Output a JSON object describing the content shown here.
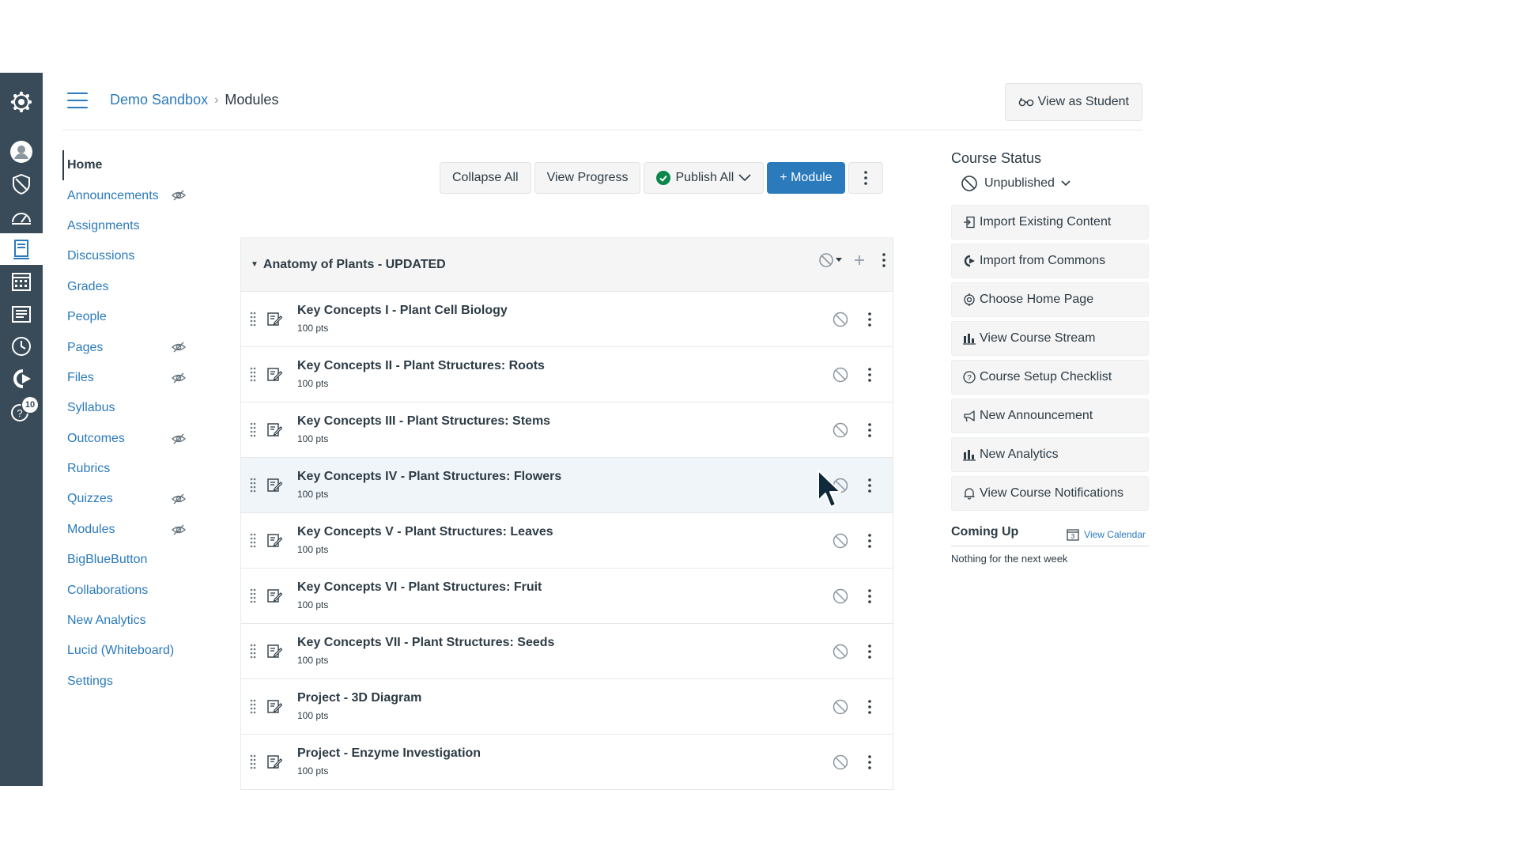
{
  "breadcrumb": {
    "course": "Demo Sandbox",
    "separator": "›",
    "current": "Modules"
  },
  "header": {
    "view_as_student": "View as Student"
  },
  "global_nav": {
    "icons": [
      "logo-icon",
      "account-icon",
      "admin-icon",
      "dashboard-icon",
      "courses-icon",
      "calendar-icon",
      "inbox-icon",
      "history-icon",
      "commons-icon",
      "help-icon"
    ],
    "help_badge": "10"
  },
  "course_nav": {
    "items": [
      {
        "label": "Home",
        "active": true,
        "hidden": false
      },
      {
        "label": "Announcements",
        "hidden": true
      },
      {
        "label": "Assignments",
        "hidden": false
      },
      {
        "label": "Discussions",
        "hidden": false
      },
      {
        "label": "Grades",
        "hidden": false
      },
      {
        "label": "People",
        "hidden": false
      },
      {
        "label": "Pages",
        "hidden": true
      },
      {
        "label": "Files",
        "hidden": true
      },
      {
        "label": "Syllabus",
        "hidden": false
      },
      {
        "label": "Outcomes",
        "hidden": true
      },
      {
        "label": "Rubrics",
        "hidden": false
      },
      {
        "label": "Quizzes",
        "hidden": true
      },
      {
        "label": "Modules",
        "hidden": true
      },
      {
        "label": "BigBlueButton",
        "hidden": false
      },
      {
        "label": "Collaborations",
        "hidden": false
      },
      {
        "label": "New Analytics",
        "hidden": false
      },
      {
        "label": "Lucid (Whiteboard)",
        "hidden": false
      },
      {
        "label": "Settings",
        "hidden": false
      }
    ]
  },
  "toolbar": {
    "collapse_all": "Collapse All",
    "view_progress": "View Progress",
    "publish_all": "Publish All",
    "add_module": "+ Module"
  },
  "module": {
    "title": "Anatomy of Plants - UPDATED",
    "items": [
      {
        "title": "Key Concepts I - Plant Cell Biology",
        "points": "100 pts"
      },
      {
        "title": "Key Concepts II - Plant Structures: Roots",
        "points": "100 pts"
      },
      {
        "title": "Key Concepts III - Plant Structures: Stems",
        "points": "100 pts"
      },
      {
        "title": "Key Concepts IV - Plant Structures: Flowers",
        "points": "100 pts",
        "hovered": true
      },
      {
        "title": "Key Concepts V - Plant Structures: Leaves",
        "points": "100 pts"
      },
      {
        "title": "Key Concepts VI - Plant Structures: Fruit",
        "points": "100 pts"
      },
      {
        "title": "Key Concepts VII - Plant Structures: Seeds",
        "points": "100 pts"
      },
      {
        "title": "Project - 3D Diagram",
        "points": "100 pts"
      },
      {
        "title": "Project - Enzyme Investigation",
        "points": "100 pts"
      }
    ]
  },
  "sidebar": {
    "course_status_title": "Course Status",
    "status_value": "Unpublished",
    "buttons": [
      {
        "label": "Import Existing Content",
        "icon": "import-icon"
      },
      {
        "label": "Import from Commons",
        "icon": "commons-icon"
      },
      {
        "label": "Choose Home Page",
        "icon": "target-icon"
      },
      {
        "label": "View Course Stream",
        "icon": "bar-chart-icon"
      },
      {
        "label": "Course Setup Checklist",
        "icon": "question-icon"
      },
      {
        "label": "New Announcement",
        "icon": "megaphone-icon"
      },
      {
        "label": "New Analytics",
        "icon": "bar-chart-icon"
      },
      {
        "label": "View Course Notifications",
        "icon": "bell-icon"
      }
    ],
    "coming_up_title": "Coming Up",
    "view_calendar": "View Calendar",
    "calendar_day": "3",
    "nothing_next": "Nothing for the next week"
  },
  "colors": {
    "nav_bg": "#394b58",
    "link": "#2b7abc",
    "text": "#2d3b45",
    "publish_green": "#0b874b"
  }
}
